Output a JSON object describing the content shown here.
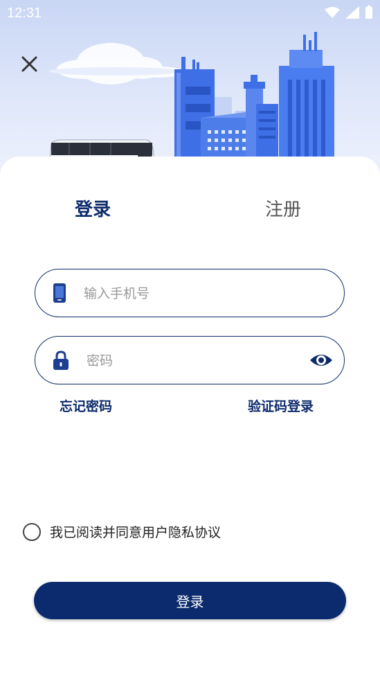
{
  "status_bar": {
    "time": "12:31"
  },
  "tabs": {
    "login": "登录",
    "register": "注册"
  },
  "phone_field": {
    "placeholder": "输入手机号",
    "value": ""
  },
  "password_field": {
    "placeholder": "密码",
    "value": ""
  },
  "links": {
    "forgot_password": "忘记密码",
    "sms_login": "验证码登录"
  },
  "agreement": {
    "text": "我已阅读并同意用户隐私协议",
    "checked": false
  },
  "login_button": {
    "label": "登录"
  },
  "colors": {
    "primary": "#0b2b6e",
    "hero_bg": "#c9d6f4",
    "building": "#4a7df0"
  }
}
